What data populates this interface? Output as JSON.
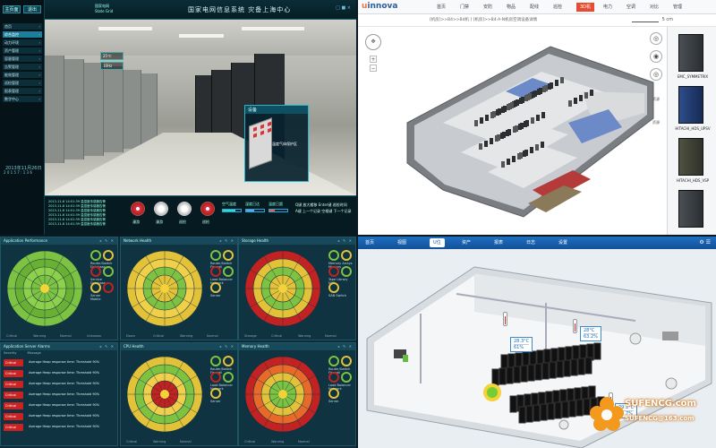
{
  "q1": {
    "tab_left": "主页面",
    "tab_right": "退出",
    "logo": "国家电网",
    "logo_sub": "State Grid",
    "title": "国家电网信息系统 灾备上海中心",
    "corner": "□ ■ ×",
    "menu": [
      {
        "label": "首页",
        "active": false
      },
      {
        "label": "综合监控",
        "active": true
      },
      {
        "label": "动力环境",
        "active": false
      },
      {
        "label": "资产管理",
        "active": false
      },
      {
        "label": "容量管理",
        "active": false
      },
      {
        "label": "告警管理",
        "active": false
      },
      {
        "label": "能效管理",
        "active": false
      },
      {
        "label": "巡检管理",
        "active": false
      },
      {
        "label": "报表管理",
        "active": false
      },
      {
        "label": "数字中心",
        "active": false
      }
    ],
    "time": "2013年11月26日",
    "date": "2 0 1 5 7 : 1 3 6",
    "info_panel": {
      "title": "设备",
      "label": "温度气体保护区",
      "values": [
        "25℃",
        "60%"
      ]
    },
    "scene_values": [
      "25℃",
      "10Hz"
    ],
    "log": [
      "2013-11-6 14:01:39  温湿度传感器告警",
      "2013-11-6 14:01:39  温湿度传感器告警",
      "2013-11-6 14:01:39  温湿度传感器告警",
      "2013-11-6 14:01:39  温湿度传感器告警",
      "2013-11-6 14:01:39  温湿度传感器告警",
      "2013-11-6 14:01:39  温湿度传感器告警"
    ],
    "knobs": [
      "漫游",
      "漫游",
      "巡检",
      "巡检"
    ],
    "gauges": [
      "空气温度",
      "湿度已达",
      "温度已超"
    ],
    "help": [
      "Q键 放大搬移   Enter键 巡检时间",
      "A键 上一个记录   空格键 下一个记录"
    ]
  },
  "q2": {
    "brand_pre": "u",
    "brand": "innova",
    "nav": [
      {
        "label": "首页",
        "active": false
      },
      {
        "label": "门禁",
        "active": false
      },
      {
        "label": "安防",
        "active": false
      },
      {
        "label": "物品",
        "active": false
      },
      {
        "label": "配线",
        "active": false
      },
      {
        "label": "巡检",
        "active": false
      },
      {
        "label": "3D机",
        "active": true
      },
      {
        "label": "电力",
        "active": false
      },
      {
        "label": "空调",
        "active": false
      },
      {
        "label": "对比",
        "active": false
      },
      {
        "label": "管理",
        "active": false
      }
    ],
    "breadcrumb": "[机房]>>B4>>B4机 ] [机房]>>B4-A-N机房空调设备详情",
    "scale": "5 cm",
    "tools": [
      "◎",
      "◉",
      "◎"
    ],
    "side_buttons": [
      "资源",
      "资源"
    ],
    "racks": [
      {
        "label": "EMC_SYMMETRIX",
        "color": "gray"
      },
      {
        "label": "HITACHI_HDS_UPSV",
        "color": "blue"
      },
      {
        "label": "HITACHI_HDS_VSP",
        "color": "olive"
      },
      {
        "label": "",
        "color": "gray"
      }
    ]
  },
  "q3": {
    "panels": [
      {
        "title": "Application Performance",
        "legend": [
          "Router/Switch",
          "Database",
          "Service",
          "Database",
          "Server",
          "Mobile"
        ],
        "foot": [
          "Critical",
          "Warning",
          "Normal",
          "Unknown"
        ]
      },
      {
        "title": "Network Health",
        "legend": [
          "Router/Switch",
          "Firewall",
          "Load Balancer",
          "Network",
          "Server"
        ],
        "foot": [
          "Down",
          "Critical",
          "Warning",
          "Normal"
        ]
      },
      {
        "title": "Storage Health",
        "legend": [
          "Memory Arrays",
          "Memory",
          "Tape Library",
          "NAS",
          "SAN Switch"
        ],
        "foot": [
          "Storage",
          "Critical",
          "Warning",
          "Normal"
        ]
      },
      {
        "title": "Application Server Alarms",
        "headers": [
          "Severity",
          "Message"
        ]
      },
      {
        "title": "CPU Health",
        "legend": [
          "Router/Switch",
          "Firewall",
          "Load Balancer",
          "Network",
          "Server"
        ],
        "foot": [
          "Critical",
          "Warning",
          "Normal"
        ]
      },
      {
        "title": "Memory Health",
        "legend": [
          "Router/Switch",
          "Firewall",
          "Load Balancer",
          "Network",
          "Server"
        ],
        "foot": [
          "Critical",
          "Warning",
          "Normal"
        ]
      }
    ],
    "alarms": [
      {
        "severity": "Critical",
        "message": "Average Heap response time: Threshold 90%"
      },
      {
        "severity": "Critical",
        "message": "Average Heap response time: Threshold 90%"
      },
      {
        "severity": "Critical",
        "message": "Average Heap response time: Threshold 90%"
      },
      {
        "severity": "Critical",
        "message": "Average Heap response time: Threshold 90%"
      },
      {
        "severity": "Critical",
        "message": "Average Heap response time: Threshold 90%"
      },
      {
        "severity": "Critical",
        "message": "Average Heap response time: Threshold 90%"
      },
      {
        "severity": "Critical",
        "message": "Average Heap response time: Threshold 90%"
      }
    ]
  },
  "q4": {
    "nav": [
      {
        "label": "首页",
        "active": false
      },
      {
        "label": "视图",
        "active": false
      },
      {
        "label": "U位",
        "active": true
      },
      {
        "label": "资产",
        "active": false
      },
      {
        "label": "报表",
        "active": false
      },
      {
        "label": "日志",
        "active": false
      },
      {
        "label": "设置",
        "active": false
      }
    ],
    "right": "⚙ ☰",
    "sensors": [
      {
        "temp": "28.3°C",
        "hum": "61%"
      },
      {
        "temp": "28°C",
        "hum": "63.2%"
      },
      {
        "temp": "29.1°C",
        "hum": "56.7%"
      }
    ],
    "watermark": "SUFENCG.com",
    "watermark_mail": "SUFENCG@163.com"
  },
  "colors": {
    "q1_accent": "#2ab3cc",
    "q2_accent": "#e74c32",
    "q3_critical": "#c22222",
    "q3_warning": "#e3c23a",
    "q3_normal": "#7dc242",
    "q4_bar": "#1f6fc0"
  }
}
